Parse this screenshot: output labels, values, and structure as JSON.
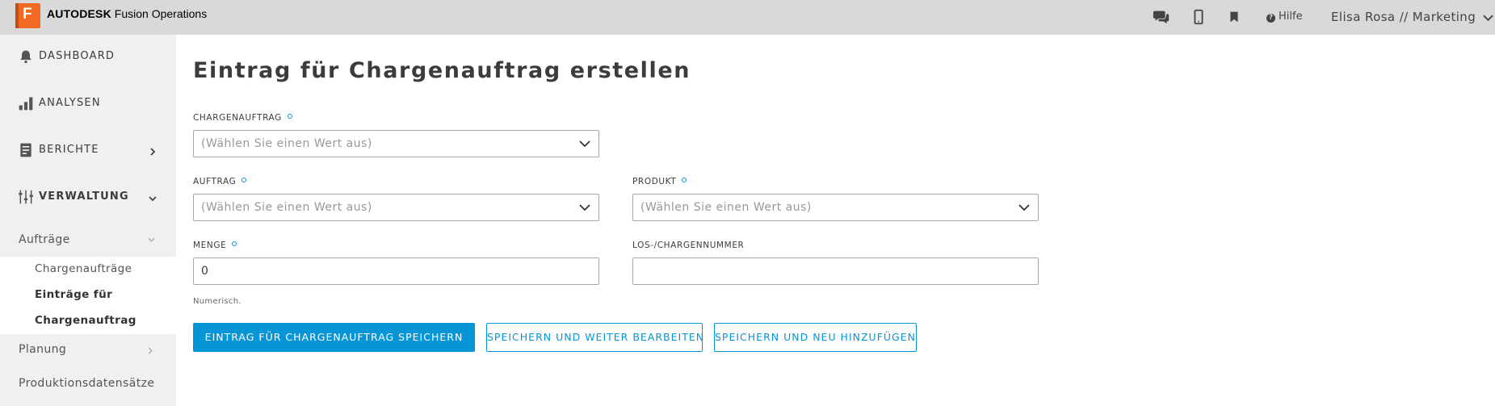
{
  "header": {
    "logo_letter": "F",
    "brand_bold": "AUTODESK",
    "brand_rest": "Fusion Operations",
    "help_label": "Hilfe",
    "user_label": "Elisa Rosa // Marketing"
  },
  "sidebar": {
    "items": [
      {
        "label": "DASHBOARD",
        "icon": "bell-icon"
      },
      {
        "label": "ANALYSEN",
        "icon": "bar-chart-icon"
      },
      {
        "label": "BERICHTE",
        "icon": "report-icon"
      },
      {
        "label": "VERWALTUNG",
        "icon": "sliders-icon"
      }
    ],
    "sub": {
      "orders": "Aufträge",
      "batch_orders": "Chargenaufträge",
      "entries_line1": "Einträge für",
      "entries_line2": "Chargenauftrag",
      "planning": "Planung",
      "production_records": "Produktionsdatensätze"
    }
  },
  "form": {
    "title": "Eintrag für Chargenauftrag erstellen",
    "batch_order_label": "CHARGENAUFTRAG",
    "batch_order_placeholder": "(Wählen Sie einen Wert aus)",
    "order_label": "AUFTRAG",
    "order_placeholder": "(Wählen Sie einen Wert aus)",
    "product_label": "PRODUKT",
    "product_placeholder": "(Wählen Sie einen Wert aus)",
    "quantity_label": "MENGE",
    "quantity_value": "0",
    "quantity_hint": "Numerisch.",
    "lot_label": "LOS-/CHARGENNUMMER",
    "lot_value": ""
  },
  "actions": {
    "save": "EINTRAG FÜR CHARGENAUFTRAG SPEICHERN",
    "save_continue": "SPEICHERN UND WEITER BEARBEITEN",
    "save_add": "SPEICHERN UND NEU HINZUFÜGEN"
  },
  "colors": {
    "accent": "#0696d7",
    "brand": "#f26922",
    "topbar": "#d9d9d9",
    "sidebar": "#f0f0f0"
  }
}
